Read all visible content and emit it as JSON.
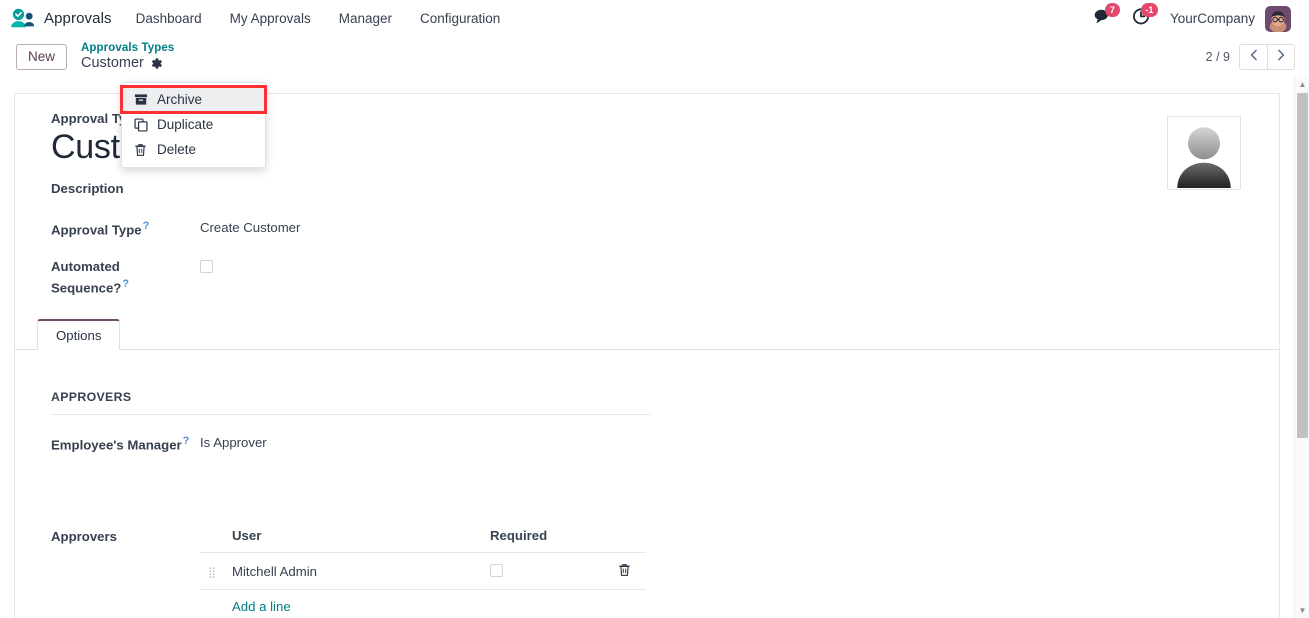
{
  "navbar": {
    "brand": "Approvals",
    "brand_logo_icon": "approvals-person-check-icon",
    "menu_items": [
      {
        "label": "Dashboard"
      },
      {
        "label": "My Approvals"
      },
      {
        "label": "Manager"
      },
      {
        "label": "Configuration"
      }
    ],
    "messages_icon": "messages-bubble-icon",
    "messages_badge": "7",
    "activities_icon": "clock-activity-icon",
    "activities_badge": "-1",
    "company": "YourCompany",
    "user_avatar_icon": "user-avatar-icon",
    "badge_color": "#e4486b"
  },
  "control_panel": {
    "new_button": "New",
    "breadcrumb_parent": "Approvals Types",
    "breadcrumb_current": "Customer",
    "gear_icon": "gear-icon",
    "breadcrumb_link_color": "#017e84",
    "pager_value": "2 / 9",
    "pager_prev_icon": "chevron-left-icon",
    "pager_next_icon": "chevron-right-icon"
  },
  "dropdown": {
    "items": [
      {
        "label": "Archive",
        "icon": "archive-box-icon",
        "highlighted": true
      },
      {
        "label": "Duplicate",
        "icon": "duplicate-copy-icon",
        "highlighted": false
      },
      {
        "label": "Delete",
        "icon": "trash-delete-icon",
        "highlighted": false
      }
    ],
    "highlight_color": "#fc3030"
  },
  "form": {
    "avatar_icon": "image-placeholder-avatar",
    "title_label": "Approval Type",
    "title_value": "Customer",
    "fields": [
      {
        "label": "Description",
        "value": "",
        "help": false
      },
      {
        "label": "Approval Type",
        "value": "Create Customer",
        "help": true
      },
      {
        "label": "Automated Sequence?",
        "value": "",
        "help": true,
        "widget": "checkbox",
        "checked": false
      }
    ],
    "description_label": "Description",
    "approval_type_label": "Approval Type",
    "approval_type_value": "Create Customer",
    "automated_sequence_label": "Automated Sequence?",
    "automated_sequence_checked": false,
    "help_marker": "?"
  },
  "notebook": {
    "tabs": [
      {
        "label": "Options",
        "active": true
      }
    ],
    "active_tab_accent": "#714b67"
  },
  "approvers_section": {
    "group_title": "APPROVERS",
    "employee_manager_label": "Employee's Manager",
    "employee_manager_value": "Is Approver",
    "list_label": "Approvers",
    "columns": [
      "User",
      "Required"
    ],
    "rows": [
      {
        "handle_icon": "drag-handle-icon",
        "user": "Mitchell Admin",
        "required": false,
        "delete_icon": "trash-icon"
      }
    ],
    "add_line_label": "Add a line",
    "add_line_color": "#017e84"
  },
  "scrollbar": {
    "up_icon": "scroll-up-arrow-icon",
    "down_icon": "scroll-down-arrow-icon"
  }
}
